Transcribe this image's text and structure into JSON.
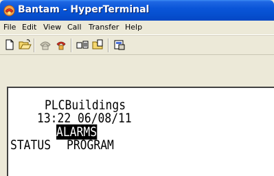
{
  "window": {
    "title": "Bantam - HyperTerminal",
    "app_icon": "hyperterminal-phone-icon"
  },
  "menubar": {
    "items": [
      {
        "label": "File"
      },
      {
        "label": "Edit"
      },
      {
        "label": "View"
      },
      {
        "label": "Call"
      },
      {
        "label": "Transfer"
      },
      {
        "label": "Help"
      }
    ]
  },
  "toolbar": {
    "buttons": [
      {
        "icon": "new-document-icon"
      },
      {
        "icon": "open-folder-icon"
      },
      {
        "icon": "connect-phone-icon"
      },
      {
        "icon": "disconnect-phone-icon"
      },
      {
        "icon": "send-file-icon"
      },
      {
        "icon": "receive-file-icon"
      },
      {
        "icon": "properties-icon"
      }
    ]
  },
  "terminal": {
    "line1": "PLCBuildings",
    "line2": "13:22 06/08/11",
    "line3_highlighted": "ALARMS",
    "line4_left": "STATUS",
    "line4_right": "PROGRAM"
  },
  "colors": {
    "titlebar": "#0a55d8",
    "terminal_bg": "#ffffff",
    "terminal_text": "#000000",
    "window_bg": "#ece9d8"
  }
}
